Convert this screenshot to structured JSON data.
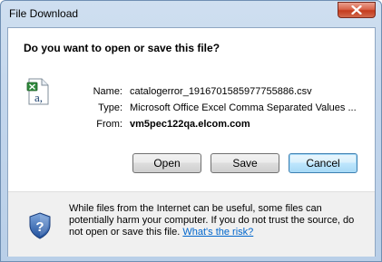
{
  "window": {
    "title": "File Download"
  },
  "dialog": {
    "question": "Do you want to open or save this file?",
    "fields": [
      {
        "label": "Name:",
        "value": "catalogerror_1916701585977755886.csv"
      },
      {
        "label": "Type:",
        "value": "Microsoft Office Excel Comma Separated Values ..."
      },
      {
        "label": "From:",
        "value": "vm5pec122qa.elcom.com"
      }
    ],
    "buttons": {
      "open": "Open",
      "save": "Save",
      "cancel": "Cancel"
    },
    "warning_text": "While files from the Internet can be useful, some files can potentially harm your computer. If you do not trust the source, do not open or save this file.",
    "risk_link": "What's the risk?"
  },
  "icons": {
    "close": "close-icon",
    "file": "excel-csv-file-icon",
    "security": "security-shield-icon"
  },
  "colors": {
    "title_bar": "#c3d6ec",
    "close_button": "#c43b1d",
    "link": "#0066cc",
    "footer_bg": "#f0f0f0"
  }
}
